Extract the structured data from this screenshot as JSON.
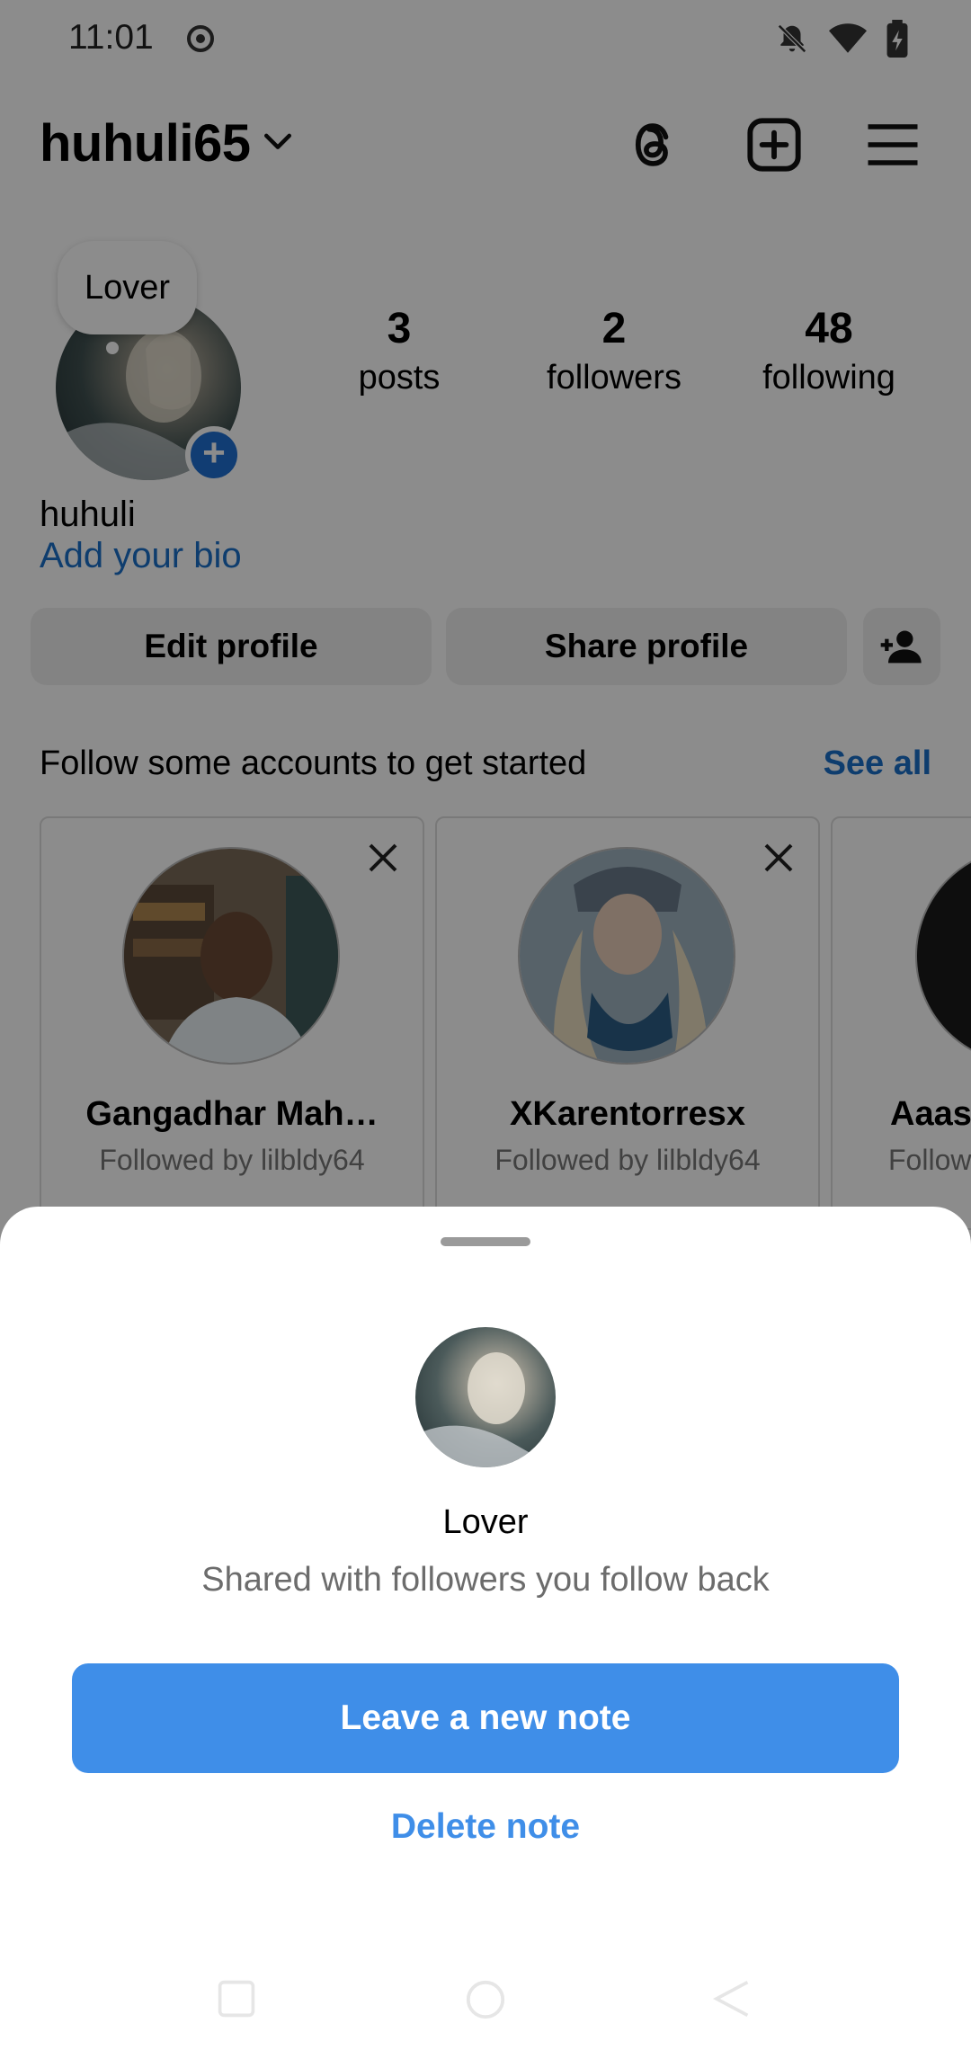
{
  "status_bar": {
    "time": "11:01"
  },
  "header": {
    "username": "huhuli65"
  },
  "profile": {
    "note": "Lover",
    "stats": [
      {
        "value": "3",
        "label": "posts"
      },
      {
        "value": "2",
        "label": "followers"
      },
      {
        "value": "48",
        "label": "following"
      }
    ],
    "display_name": "huhuli",
    "bio_link": "Add your bio",
    "edit_label": "Edit profile",
    "share_label": "Share profile"
  },
  "suggestions": {
    "title": "Follow some accounts to get started",
    "see_all": "See all",
    "cards": [
      {
        "name": "Gangadhar Mah…",
        "sub": "Followed by lilbldy64"
      },
      {
        "name": "XKarentorresx",
        "sub": "Followed by lilbldy64"
      },
      {
        "name": "Aaasl",
        "sub": "Follow"
      }
    ]
  },
  "sheet": {
    "title": "Lover",
    "subtitle": "Shared with followers you follow back",
    "primary": "Leave a new note",
    "secondary": "Delete note"
  },
  "colors": {
    "accent": "#3f8ee8",
    "link": "#1b6fc9"
  }
}
